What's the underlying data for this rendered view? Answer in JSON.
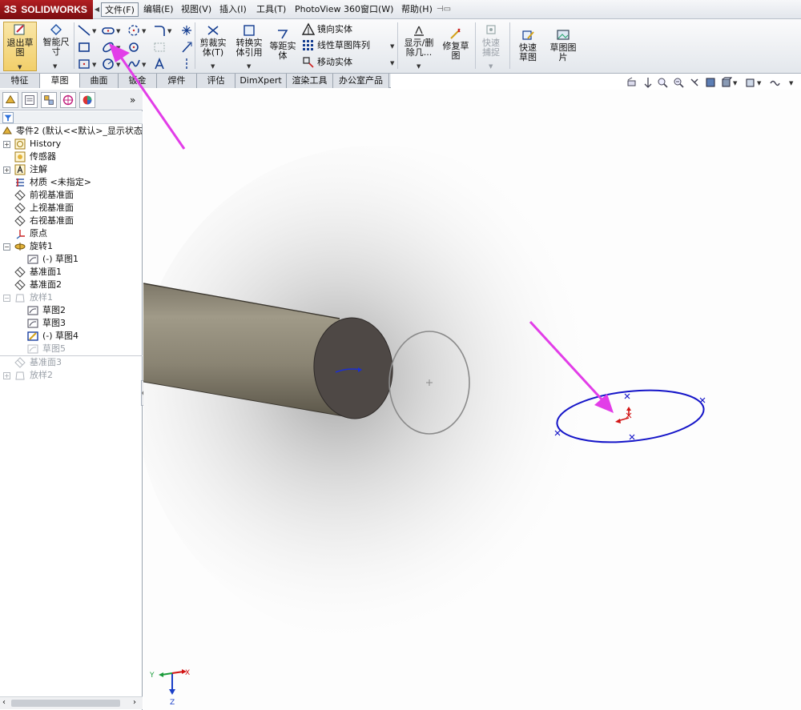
{
  "app": {
    "logo_text": "SOLIDWORKS",
    "logo_prefix": "3S"
  },
  "menubar": {
    "items": [
      "文件(F)",
      "编辑(E)",
      "视图(V)",
      "插入(I)",
      "工具(T)",
      "PhotoView 360",
      "窗口(W)",
      "帮助(H)"
    ]
  },
  "toolbar": {
    "exit_sketch": "退出草图",
    "smart_dim": "智能尺寸",
    "trim": "剪裁实体(T)",
    "convert": "转换实体引用",
    "offset": "等距实体",
    "mirror": "镜向实体",
    "linear_pattern": "线性草图阵列",
    "move": "移动实体",
    "show_delete": "显示/删除几...",
    "repair": "修复草图",
    "quick_snap": "快速捕捉",
    "rapid_sketch": "快速草图",
    "sketch_picture": "草图图片"
  },
  "tabs": [
    "特征",
    "草图",
    "曲面",
    "钣金",
    "焊件",
    "评估",
    "DimXpert",
    "渲染工具",
    "办公室产品"
  ],
  "active_tab": "草图",
  "tree": {
    "root": "零件2 (默认<<默认>_显示状态",
    "items": [
      {
        "label": "History"
      },
      {
        "label": "传感器"
      },
      {
        "label": "注解"
      },
      {
        "label": "材质 <未指定>"
      },
      {
        "label": "前视基准面"
      },
      {
        "label": "上视基准面"
      },
      {
        "label": "右视基准面"
      },
      {
        "label": "原点"
      },
      {
        "label": "旋转1"
      },
      {
        "label": "(-) 草图1"
      },
      {
        "label": "基准面1"
      },
      {
        "label": "基准面2"
      },
      {
        "label": "放样1"
      },
      {
        "label": "草图2"
      },
      {
        "label": "草图3"
      },
      {
        "label": "(-) 草图4"
      },
      {
        "label": "草图5"
      },
      {
        "label": "基准面3"
      },
      {
        "label": "放样2"
      }
    ]
  },
  "triad": {
    "y": "Y",
    "x": "X",
    "z": "Z"
  },
  "colors": {
    "accent_blue": "#1a1aa8",
    "arrow_magenta": "#e23de8",
    "logo_red": "#9b1418",
    "cylinder": "#8c8677",
    "cylinder_end": "#4e4845"
  }
}
